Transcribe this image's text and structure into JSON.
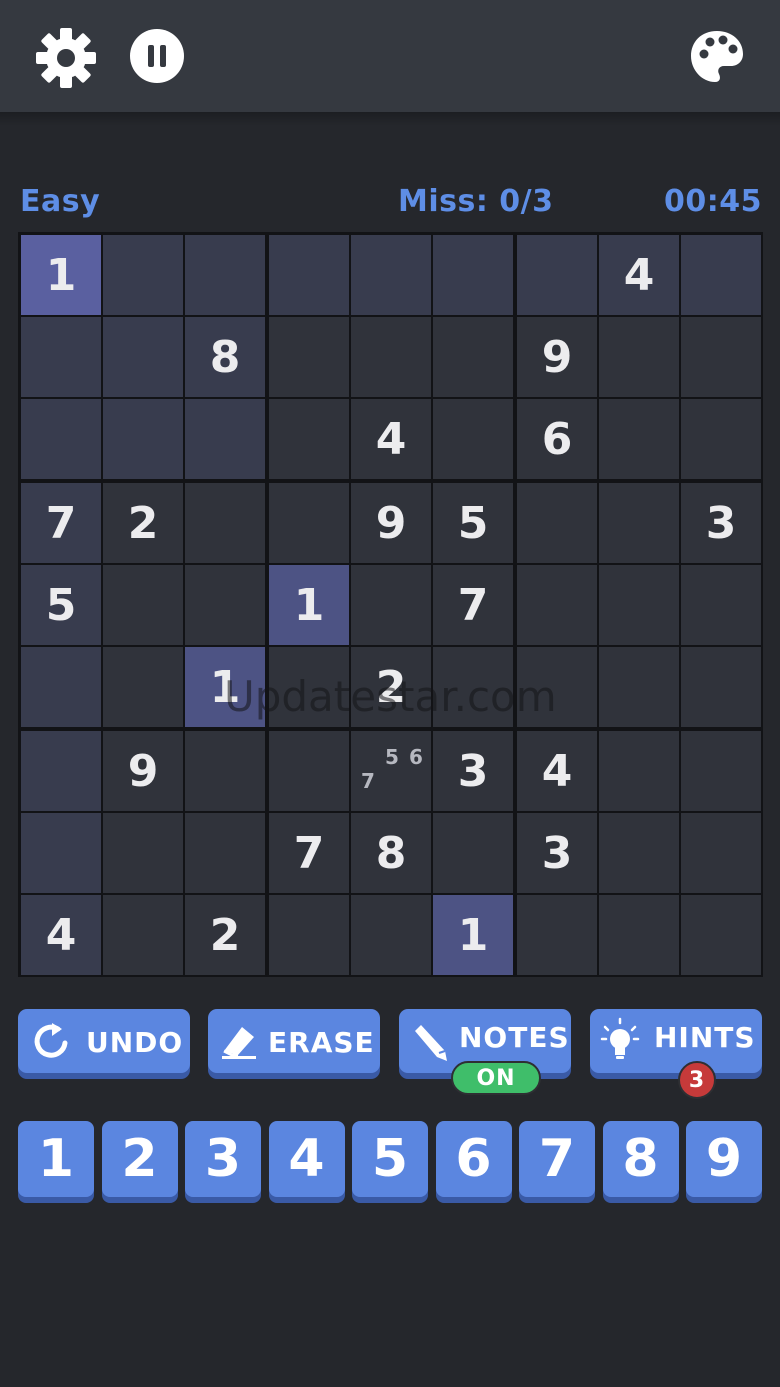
{
  "header": {
    "settings_icon": "gear-icon",
    "pause_icon": "pause-icon",
    "theme_icon": "palette-icon"
  },
  "status": {
    "difficulty": "Easy",
    "misses": "Miss: 0/3",
    "timer": "00:45"
  },
  "board": {
    "grid": [
      [
        1,
        0,
        0,
        0,
        0,
        0,
        0,
        4,
        0
      ],
      [
        0,
        0,
        8,
        0,
        0,
        0,
        9,
        0,
        0
      ],
      [
        0,
        0,
        0,
        0,
        4,
        0,
        6,
        0,
        0
      ],
      [
        7,
        2,
        0,
        0,
        9,
        5,
        0,
        0,
        3
      ],
      [
        5,
        0,
        0,
        1,
        0,
        7,
        0,
        0,
        0
      ],
      [
        0,
        0,
        1,
        0,
        2,
        0,
        0,
        0,
        0
      ],
      [
        0,
        9,
        0,
        0,
        0,
        3,
        4,
        0,
        0
      ],
      [
        0,
        0,
        0,
        7,
        8,
        0,
        3,
        0,
        0
      ],
      [
        4,
        0,
        2,
        0,
        0,
        1,
        0,
        0,
        0
      ]
    ],
    "selected": [
      0,
      0
    ],
    "notes": [
      {
        "row": 6,
        "col": 4,
        "values": [
          "5",
          "6",
          "7"
        ]
      }
    ]
  },
  "watermark": "Updatestar.com",
  "tools": {
    "undo_label": "UNDO",
    "erase_label": "ERASE",
    "notes_label": "NOTES",
    "notes_state": "ON",
    "hints_label": "HINTS",
    "hints_count": "3"
  },
  "numpad": [
    "1",
    "2",
    "3",
    "4",
    "5",
    "6",
    "7",
    "8",
    "9"
  ],
  "colors": {
    "accent": "#5b86e0",
    "status_text": "#5e8ee6",
    "selected_cell": "#5a60a0",
    "same_number_cell": "#4d5384",
    "related_cell": "#383c4e",
    "notes_on": "#3fbe6a",
    "hint_badge": "#c63a3a"
  }
}
